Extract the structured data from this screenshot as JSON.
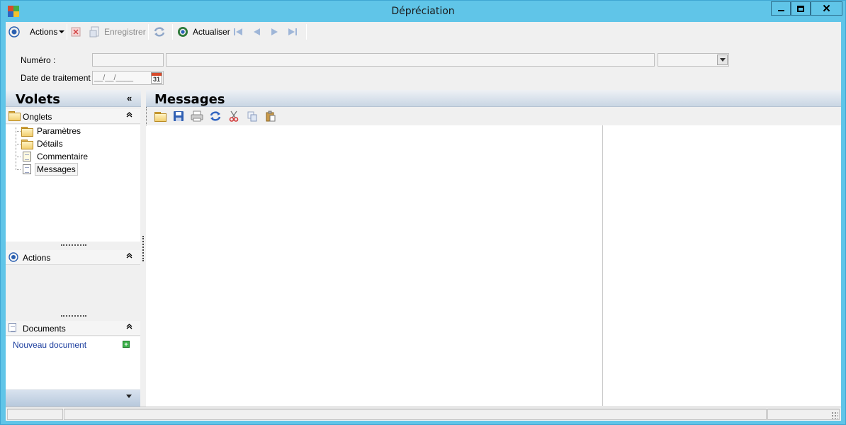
{
  "window": {
    "title": "Dépréciation"
  },
  "toolbar": {
    "actions_label": "Actions",
    "save_label": "Enregistrer",
    "refresh_label": "Actualiser"
  },
  "form": {
    "numero_label": "Numéro :",
    "numero_value": "",
    "description_value": "",
    "select_value": "",
    "date_label": "Date de traitement :",
    "date_placeholder": "__/__/____",
    "calendar_day": "31"
  },
  "left_panel": {
    "title": "Volets",
    "collapse_glyph": "«",
    "onglets": {
      "title": "Onglets",
      "items": [
        {
          "label": "Paramètres",
          "icon": "folder-icon"
        },
        {
          "label": "Détails",
          "icon": "folder-icon"
        },
        {
          "label": "Commentaire",
          "icon": "document-icon"
        },
        {
          "label": "Messages",
          "icon": "document-icon",
          "selected": true
        }
      ]
    },
    "actions": {
      "title": "Actions"
    },
    "documents": {
      "title": "Documents",
      "new_document_label": "Nouveau document"
    }
  },
  "main_panel": {
    "title": "Messages",
    "toolbar_icons": [
      "open-folder-icon",
      "save-icon",
      "print-icon",
      "refresh-icon",
      "cut-icon",
      "copy-icon",
      "paste-icon"
    ]
  },
  "colors": {
    "titlebar": "#60c5e8",
    "header_gradient_top": "#eef1f5",
    "header_gradient_bottom": "#c9d6e4",
    "link": "#1b3d9e"
  }
}
